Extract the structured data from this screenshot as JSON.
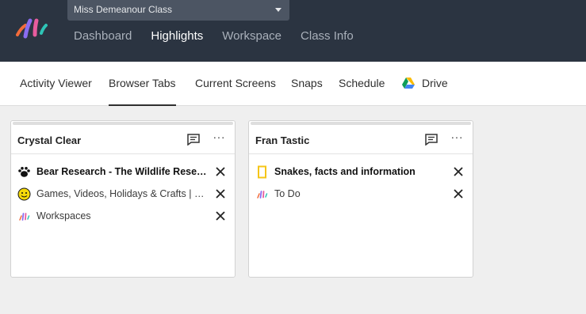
{
  "header": {
    "class_select": "Miss Demeanour Class",
    "nav": [
      "Dashboard",
      "Highlights",
      "Workspace",
      "Class Info"
    ],
    "active_nav": "Highlights"
  },
  "subnav": {
    "tabs": [
      "Activity Viewer",
      "Browser Tabs",
      "Current Screens",
      "Snaps",
      "Schedule",
      "Drive"
    ],
    "active": "Browser Tabs"
  },
  "cards": [
    {
      "student": "Crystal Clear",
      "tabs": [
        {
          "title": "Bear Research - The Wildlife Research Institute",
          "icon": "paw-icon",
          "bold": true
        },
        {
          "title": "Games, Videos, Holidays & Crafts | PBS KIDS",
          "icon": "smiley-icon",
          "bold": false
        },
        {
          "title": "Workspaces",
          "icon": "app-logo-icon",
          "bold": false
        }
      ]
    },
    {
      "student": "Fran Tastic",
      "tabs": [
        {
          "title": "Snakes, facts and information",
          "icon": "natgeo-frame-icon",
          "bold": true
        },
        {
          "title": "To Do",
          "icon": "app-logo-icon",
          "bold": false
        }
      ]
    }
  ],
  "colors": {
    "topbar": "#2b3441",
    "accent_yellow": "#f5c518"
  }
}
